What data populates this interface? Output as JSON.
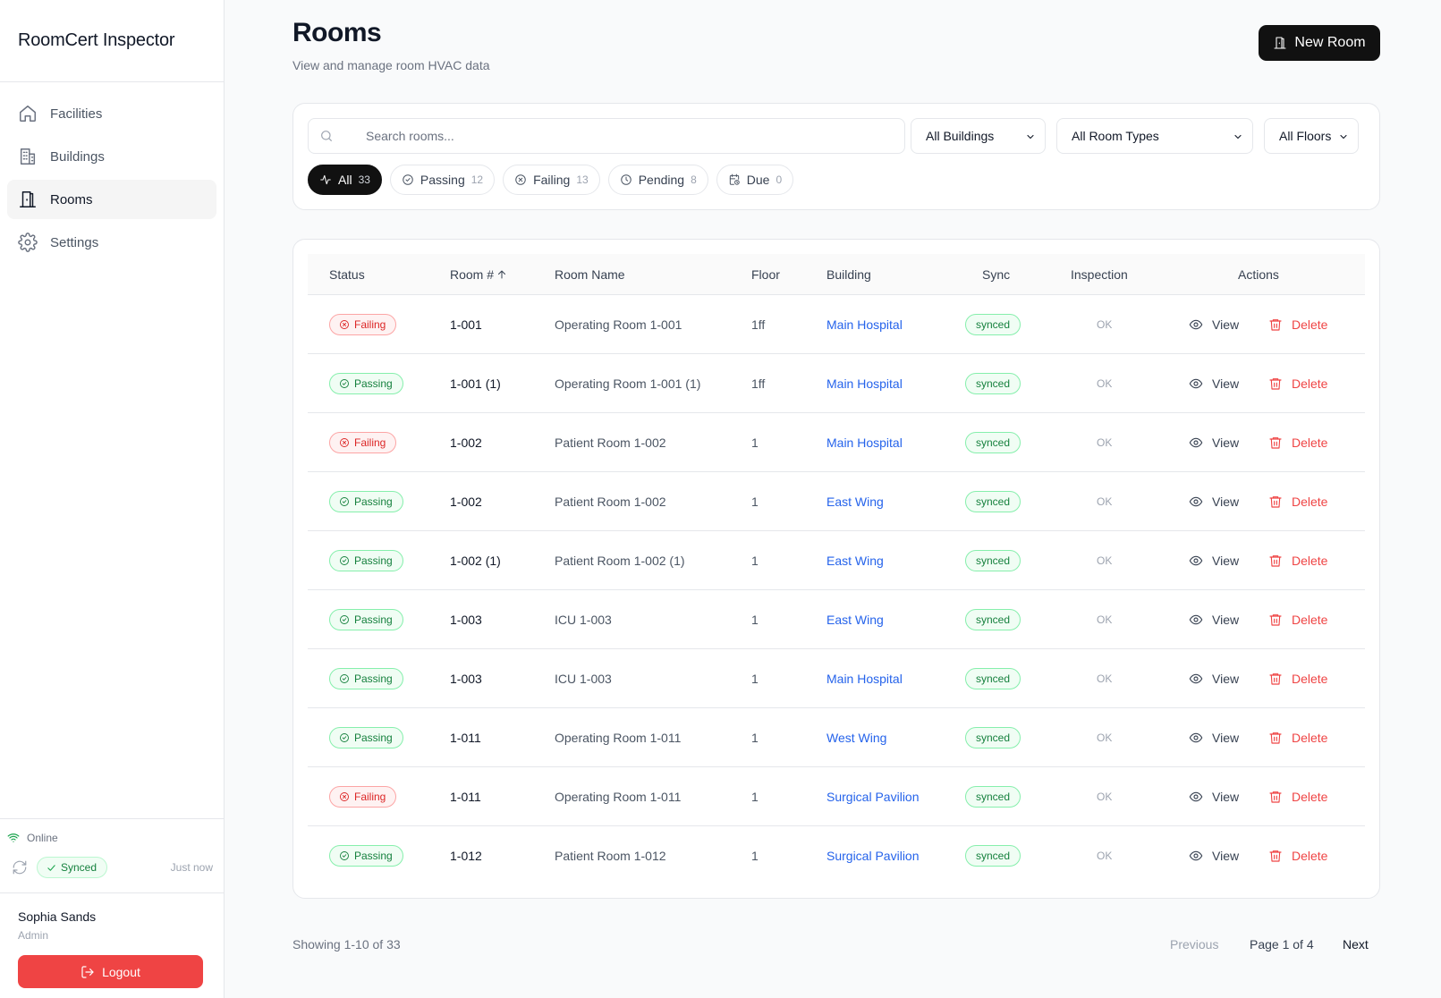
{
  "app": {
    "name": "RoomCert Inspector"
  },
  "sidebar": {
    "items": [
      {
        "label": "Facilities",
        "icon": "home-icon",
        "active": false
      },
      {
        "label": "Buildings",
        "icon": "building-icon",
        "active": false
      },
      {
        "label": "Rooms",
        "icon": "door-icon",
        "active": true
      },
      {
        "label": "Settings",
        "icon": "gear-icon",
        "active": false
      }
    ],
    "connection": "Online",
    "sync_status": "Synced",
    "sync_time": "Just now",
    "user": {
      "name": "Sophia Sands",
      "role": "Admin"
    },
    "logout_label": "Logout"
  },
  "header": {
    "title": "Rooms",
    "subtitle": "View and manage room HVAC data",
    "new_button": "New Room"
  },
  "filters": {
    "search_placeholder": "Search rooms...",
    "building": "All Buildings",
    "room_type": "All Room Types",
    "floor": "All Floors",
    "chips": [
      {
        "label": "All",
        "count": "33",
        "icon": "activity-icon",
        "active": true
      },
      {
        "label": "Passing",
        "count": "12",
        "icon": "check-circle-icon",
        "active": false
      },
      {
        "label": "Failing",
        "count": "13",
        "icon": "x-circle-icon",
        "active": false
      },
      {
        "label": "Pending",
        "count": "8",
        "icon": "clock-icon",
        "active": false
      },
      {
        "label": "Due",
        "count": "0",
        "icon": "calendar-clock-icon",
        "active": false
      }
    ]
  },
  "table": {
    "columns": {
      "status": "Status",
      "room": "Room #",
      "name": "Room Name",
      "floor": "Floor",
      "building": "Building",
      "sync": "Sync",
      "inspection": "Inspection",
      "actions": "Actions"
    },
    "view_label": "View",
    "delete_label": "Delete",
    "rows": [
      {
        "status": "Failing",
        "room": "1-001",
        "name": "Operating Room 1-001",
        "floor": "1ff",
        "building": "Main Hospital",
        "sync": "synced",
        "inspection": "OK"
      },
      {
        "status": "Passing",
        "room": "1-001 (1)",
        "name": "Operating Room 1-001 (1)",
        "floor": "1ff",
        "building": "Main Hospital",
        "sync": "synced",
        "inspection": "OK"
      },
      {
        "status": "Failing",
        "room": "1-002",
        "name": "Patient Room 1-002",
        "floor": "1",
        "building": "Main Hospital",
        "sync": "synced",
        "inspection": "OK"
      },
      {
        "status": "Passing",
        "room": "1-002",
        "name": "Patient Room 1-002",
        "floor": "1",
        "building": "East Wing",
        "sync": "synced",
        "inspection": "OK"
      },
      {
        "status": "Passing",
        "room": "1-002 (1)",
        "name": "Patient Room 1-002 (1)",
        "floor": "1",
        "building": "East Wing",
        "sync": "synced",
        "inspection": "OK"
      },
      {
        "status": "Passing",
        "room": "1-003",
        "name": "ICU 1-003",
        "floor": "1",
        "building": "East Wing",
        "sync": "synced",
        "inspection": "OK"
      },
      {
        "status": "Passing",
        "room": "1-003",
        "name": "ICU 1-003",
        "floor": "1",
        "building": "Main Hospital",
        "sync": "synced",
        "inspection": "OK"
      },
      {
        "status": "Passing",
        "room": "1-011",
        "name": "Operating Room 1-011",
        "floor": "1",
        "building": "West Wing",
        "sync": "synced",
        "inspection": "OK"
      },
      {
        "status": "Failing",
        "room": "1-011",
        "name": "Operating Room 1-011",
        "floor": "1",
        "building": "Surgical Pavilion",
        "sync": "synced",
        "inspection": "OK"
      },
      {
        "status": "Passing",
        "room": "1-012",
        "name": "Patient Room 1-012",
        "floor": "1",
        "building": "Surgical Pavilion",
        "sync": "synced",
        "inspection": "OK"
      }
    ]
  },
  "pagination": {
    "showing": "Showing 1-10 of 33",
    "previous": "Previous",
    "page_info": "Page 1 of 4",
    "next": "Next"
  }
}
